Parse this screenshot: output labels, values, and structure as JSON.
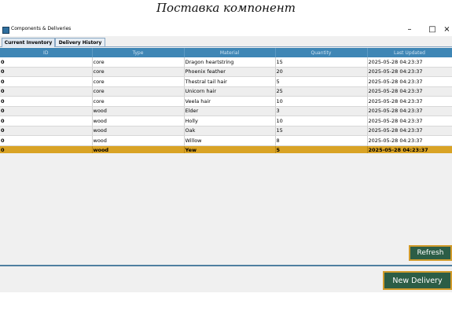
{
  "caption": "Поставка компонент",
  "window": {
    "title": "Components & Deliveries",
    "minimize": "–",
    "maximize": "□",
    "close": "×"
  },
  "tabs": [
    {
      "label": "Current Inventory",
      "active": true
    },
    {
      "label": "Delivery History",
      "active": false
    }
  ],
  "table": {
    "columns": [
      "ID",
      "Type",
      "Material",
      "Quantity",
      "Last Updated"
    ],
    "rows": [
      [
        "0",
        "core",
        "Dragon heartstring",
        "15",
        "2025-05-28 04:23:37"
      ],
      [
        "0",
        "core",
        "Phoenix feather",
        "20",
        "2025-05-28 04:23:37"
      ],
      [
        "0",
        "core",
        "Thestral tail hair",
        "5",
        "2025-05-28 04:23:37"
      ],
      [
        "0",
        "core",
        "Unicorn hair",
        "25",
        "2025-05-28 04:23:37"
      ],
      [
        "0",
        "core",
        "Veela hair",
        "10",
        "2025-05-28 04:23:37"
      ],
      [
        "0",
        "wood",
        "Elder",
        "3",
        "2025-05-28 04:23:37"
      ],
      [
        "0",
        "wood",
        "Holly",
        "10",
        "2025-05-28 04:23:37"
      ],
      [
        "0",
        "wood",
        "Oak",
        "15",
        "2025-05-28 04:23:37"
      ],
      [
        "0",
        "wood",
        "Willow",
        "8",
        "2025-05-28 04:23:37"
      ],
      [
        "0",
        "wood",
        "Yew",
        "5",
        "2025-05-28 04:23:37"
      ]
    ],
    "selected_row": 9
  },
  "buttons": {
    "refresh": "Refresh",
    "new_delivery": "New Delivery"
  },
  "colors": {
    "header": "#3f86b5",
    "selection": "#d9a325",
    "button_bg": "#2c5d46",
    "button_border": "#d19b2b"
  }
}
